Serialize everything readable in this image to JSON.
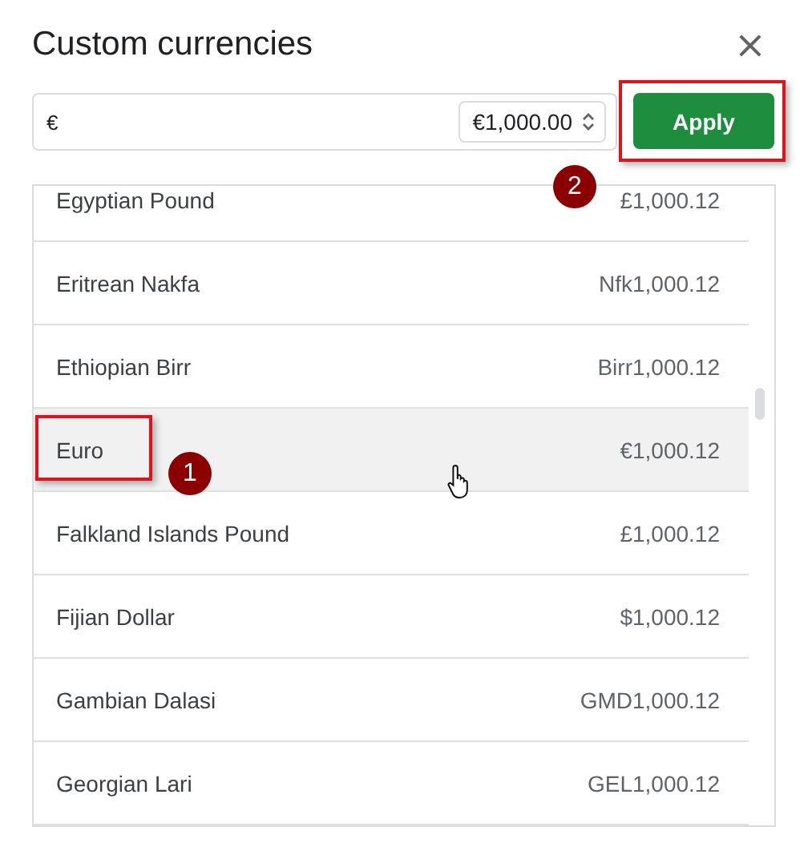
{
  "dialog": {
    "title": "Custom currencies",
    "close": "×"
  },
  "currency_field": {
    "value": "€"
  },
  "format_select": {
    "value": "€1,000.00"
  },
  "apply_button": {
    "label": "Apply",
    "highlighted": true,
    "marker": "2"
  },
  "currencies": [
    {
      "name": "Egyptian Pound",
      "example": "£1,000.12",
      "hovered": false,
      "highlighted": false
    },
    {
      "name": "Eritrean Nakfa",
      "example": "Nfk1,000.12",
      "hovered": false,
      "highlighted": false
    },
    {
      "name": "Ethiopian Birr",
      "example": "Birr1,000.12",
      "hovered": false,
      "highlighted": false
    },
    {
      "name": "Euro",
      "example": "€1,000.12",
      "hovered": true,
      "highlighted": true,
      "marker": "1"
    },
    {
      "name": "Falkland Islands Pound",
      "example": "£1,000.12",
      "hovered": false,
      "highlighted": false
    },
    {
      "name": "Fijian Dollar",
      "example": "$1,000.12",
      "hovered": false,
      "highlighted": false
    },
    {
      "name": "Gambian Dalasi",
      "example": "GMD1,000.12",
      "hovered": false,
      "highlighted": false
    },
    {
      "name": "Georgian Lari",
      "example": "GEL1,000.12",
      "hovered": false,
      "highlighted": false
    }
  ]
}
